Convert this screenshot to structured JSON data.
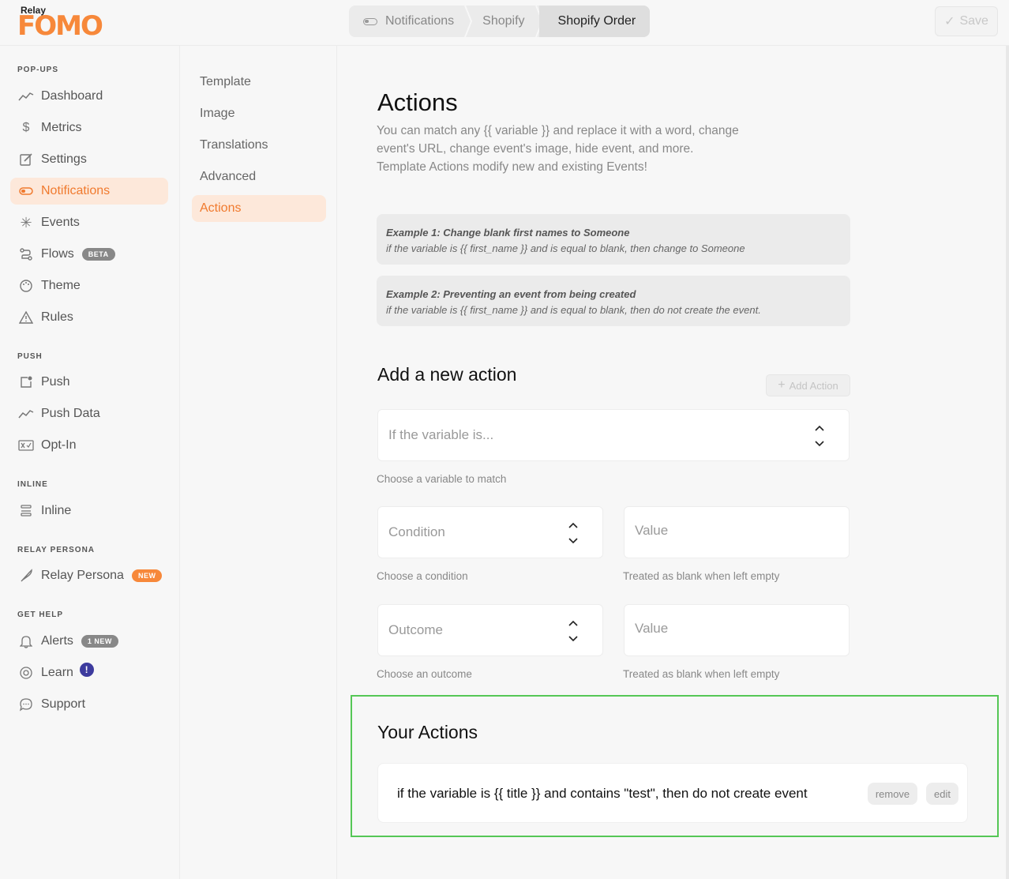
{
  "app": {
    "logo_small": "Relay",
    "logo_big": "FOMO",
    "brand_color": "#f7883a"
  },
  "breadcrumb": [
    "Notifications",
    "Shopify",
    "Shopify Order"
  ],
  "save_label": "Save",
  "nav": {
    "sections": {
      "popups": "POP-UPS",
      "push": "PUSH",
      "inline": "INLINE",
      "persona": "RELAY PERSONA",
      "help": "GET HELP"
    },
    "items": {
      "dashboard": "Dashboard",
      "metrics": "Metrics",
      "settings": "Settings",
      "notifications": "Notifications",
      "events": "Events",
      "flows": "Flows",
      "theme": "Theme",
      "rules": "Rules",
      "push": "Push",
      "push_data": "Push Data",
      "opt_in": "Opt-In",
      "inline": "Inline",
      "relay_persona": "Relay Persona",
      "alerts": "Alerts",
      "learn": "Learn",
      "support": "Support"
    },
    "badges": {
      "flows": "BETA",
      "persona": "NEW",
      "alerts": "1 NEW",
      "learn": "!"
    }
  },
  "subnav": [
    "Template",
    "Image",
    "Translations",
    "Advanced",
    "Actions"
  ],
  "main": {
    "title": "Actions",
    "desc_line1": "You can match any {{ variable }} and replace it with a word, change",
    "desc_line2": "event's URL, change event's image, hide event, and more.",
    "desc_line3": "Template Actions modify new and existing Events!",
    "example1_title": "Example 1: Change blank first names to Someone",
    "example1_text": "if the variable is {{ first_name }} and is equal to blank, then change to Someone",
    "example2_title": "Example 2: Preventing an event from being created",
    "example2_text": "if the variable is {{ first_name }} and is equal to blank, then do not create the event.",
    "add_title": "Add a new action",
    "add_button": "Add Action",
    "variable_placeholder": "If the variable is...",
    "variable_help": "Choose a variable to match",
    "condition_placeholder": "Condition",
    "condition_help": "Choose a condition",
    "value_placeholder": "Value",
    "value_help": "Treated as blank when left empty",
    "outcome_placeholder": "Outcome",
    "outcome_help": "Choose an outcome",
    "value2_placeholder": "Value",
    "value2_help": "Treated as blank when left empty",
    "your_actions_title": "Your Actions",
    "action_text": "if the variable is {{ title }} and contains \"test\", then do not create event",
    "remove_label": "remove",
    "edit_label": "edit"
  }
}
